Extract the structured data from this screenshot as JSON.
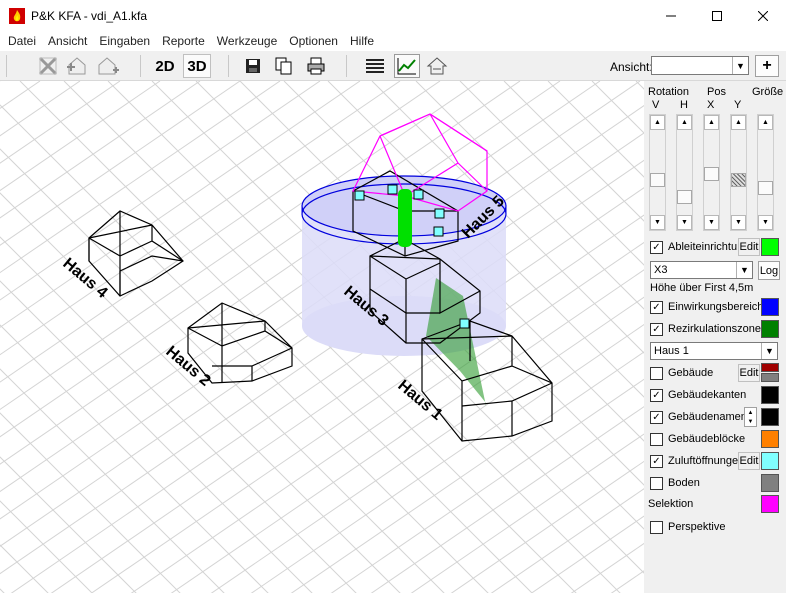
{
  "window": {
    "title": "P&K KFA - vdi_A1.kfa"
  },
  "menu": [
    "Datei",
    "Ansicht",
    "Eingaben",
    "Reporte",
    "Werkzeuge",
    "Optionen",
    "Hilfe"
  ],
  "toolbar": {
    "btn_2d": "2D",
    "btn_3d": "3D",
    "ansicht_label": "Ansicht:",
    "ansicht_value": "",
    "plus": "+"
  },
  "scene": {
    "haus1": "Haus 1",
    "haus2": "Haus 2",
    "haus3": "Haus 3",
    "haus4": "Haus 4",
    "haus5": "Haus 5"
  },
  "panel": {
    "rotation_label": "Rotation",
    "pos_label": "Pos",
    "groesse_label": "Größe",
    "v": "V",
    "h": "H",
    "x": "X",
    "y": "Y",
    "sliders": [
      0.6,
      0.84,
      0.52,
      0.6,
      0.72
    ],
    "ableit_label": "Ableiteinrichtu",
    "ableit_color": "#00ff00",
    "x3_value": "X3",
    "log": "Log",
    "hoehe_text": "Höhe über First 4,5m",
    "einwirk_label": "Einwirkungsbereich",
    "einwirk_color": "#0000ff",
    "rezirk_label": "Rezirkulationszone",
    "rezirk_color": "#008000",
    "haus_select": "Haus 1",
    "gebaeude_label": "Gebäude",
    "gebaeude_colors": [
      "#a00000",
      "#808080"
    ],
    "kanten_label": "Gebäudekanten",
    "kanten_color": "#000000",
    "namen_label": "Gebäudenamen",
    "namen_color": "#000000",
    "bloecke_label": "Gebäudeblöcke",
    "bloecke_color": "#ff8000",
    "zuluft_label": "Zuluftöffnunge",
    "zuluft_color": "#80ffff",
    "boden_label": "Boden",
    "boden_color": "#808080",
    "selektion_label": "Selektion",
    "selektion_color": "#ff00ff",
    "perspektive_label": "Perspektive",
    "edit": "Edit",
    "checked": "✓"
  }
}
